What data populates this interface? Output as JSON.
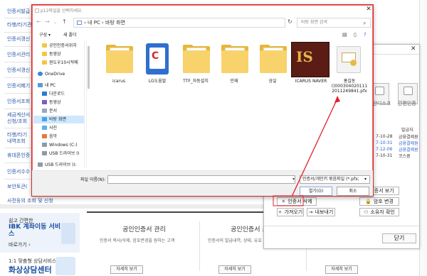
{
  "left_menu": [
    "인증서발급",
    "타행/타기관",
    "인증서갱신",
    "인증서관리",
    "인증서갱신",
    "인증서폐기",
    "인증서조회",
    "세금계산서",
    "신청/조회",
    "타행/타기",
    "내역조회",
    "휴대폰인증",
    "인증서수수",
    "보안토큰(",
    "사전등의 조회 및 신청"
  ],
  "promo": {
    "small": "쉽고 간편한",
    "headline": "IBK 계좌이동 서비스",
    "link": "바로가기 ›",
    "q_small": "1:1 맞춤형 상담서비스",
    "q_big": "화상상담센터"
  },
  "cards": [
    {
      "title": "공인인증서 관리",
      "desc": "인증서 복사/삭제, 암호변경을 원하는 고객",
      "button": "자세히 보기"
    },
    {
      "title": "공인인증서 조회",
      "desc": "인증서의 발급내역, 상태, 유효 정보 확인",
      "button": "자세히 보기"
    },
    {
      "title": "",
      "desc": "",
      "button": "자세히 보기"
    }
  ],
  "cert_dialog": {
    "media": [
      "보안디스크",
      "간편인증"
    ],
    "issuer_header": "발급자",
    "dates": [
      "7-10-28",
      "7-10-31",
      "7-12-06",
      "7-10-31"
    ],
    "issuers": [
      "금융결제원",
      "금융결제원",
      "금융결제원",
      "코스콤"
    ],
    "buttons": {
      "view_cert": "인증서 보기",
      "delete_cert": "인증서 삭제",
      "change_pw": "암호 변경",
      "import": "가져오기",
      "export": "내보내기",
      "owner_check": "소유자 확인",
      "close": "닫기"
    }
  },
  "file_dialog": {
    "title": "p12파일을 선택하세요.",
    "address": "› 내 PC › 바탕 화면",
    "search_placeholder": "바탕 화면 검색",
    "toolbar": {
      "organize": "구성 ▾",
      "new_folder": "새 폴더"
    },
    "nav": [
      {
        "label": "공인인증서위치",
        "icon": "folder"
      },
      {
        "label": "동영상",
        "icon": "folder"
      },
      {
        "label": "윈도우10시작메",
        "icon": "folder"
      },
      {
        "label": "OneDrive",
        "icon": "cloud"
      },
      {
        "label": "내 PC",
        "icon": "pc"
      },
      {
        "label": "다운로드",
        "icon": "download"
      },
      {
        "label": "동영상",
        "icon": "video"
      },
      {
        "label": "문서",
        "icon": "doc"
      },
      {
        "label": "바탕 화면",
        "icon": "desktop"
      },
      {
        "label": "사진",
        "icon": "picture"
      },
      {
        "label": "음악",
        "icon": "music"
      },
      {
        "label": "Windows (C:)",
        "icon": "drive"
      },
      {
        "label": "USB 드라이브 (I",
        "icon": "drive"
      },
      {
        "label": "USB 드라이브 (I:",
        "icon": "drive"
      }
    ],
    "files": [
      {
        "label": "icarus",
        "kind": "folder"
      },
      {
        "label": "LG도움말",
        "kind": "app"
      },
      {
        "label": "TTF_자동설치",
        "kind": "folder"
      },
      {
        "label": "민재",
        "kind": "folder"
      },
      {
        "label": "상실",
        "kind": "folder"
      },
      {
        "label": "ICARUS NAVER",
        "kind": "game"
      },
      {
        "label": "홍길동()000304020111 2011249841.pfx",
        "kind": "pfx"
      }
    ],
    "game_text": "IS",
    "filename_label": "파일 이름(N):",
    "filetype": "인증서/개인키 묶음파일 (*.pfx;",
    "open": "열기(O)",
    "cancel": "취소"
  },
  "colors": {
    "accent": "#2a56a8",
    "annotation": "#e0202a",
    "selected": "#cde8ff"
  }
}
